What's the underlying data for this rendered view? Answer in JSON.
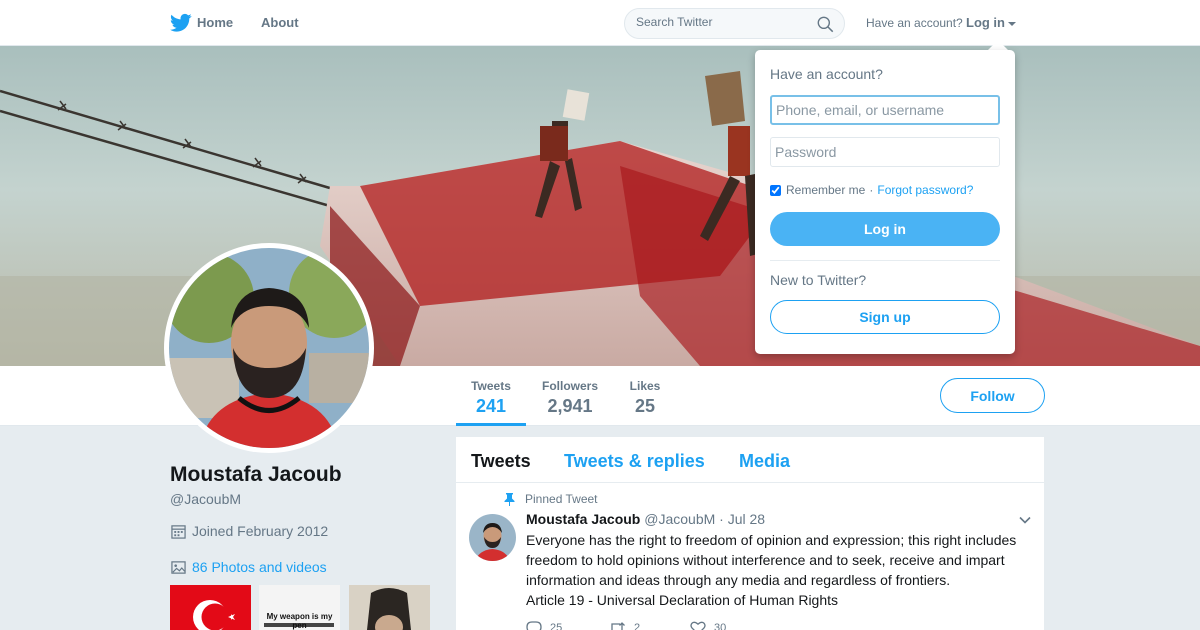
{
  "nav": {
    "home_label": "Home",
    "about_label": "About",
    "search_placeholder": "Search Twitter",
    "account_question": "Have an account?",
    "login_label": "Log in"
  },
  "profile": {
    "name": "Moustafa Jacoub",
    "handle": "@JacoubM",
    "joined": "Joined February 2012",
    "photos_link": "86 Photos and videos",
    "thumb2_caption": "My weapon is my pen"
  },
  "stats": [
    {
      "label": "Tweets",
      "value": "241"
    },
    {
      "label": "Followers",
      "value": "2,941"
    },
    {
      "label": "Likes",
      "value": "25"
    }
  ],
  "follow_label": "Follow",
  "timeline": {
    "tabs": [
      "Tweets",
      "Tweets & replies",
      "Media"
    ],
    "pinned_label": "Pinned Tweet",
    "tweet": {
      "author": "Moustafa Jacoub",
      "handle": "@JacoubM",
      "date": "Jul 28",
      "line1": "Everyone has the right to freedom of opinion and expression; this right includes",
      "line2": "freedom to hold opinions without interference and to seek, receive and impart",
      "line3": "information and ideas through any media and regardless of frontiers.",
      "line4": "Article 19 - Universal Declaration of Human Rights",
      "replies": "25",
      "retweets": "2",
      "likes": "30"
    }
  },
  "login_dropdown": {
    "title": "Have an account?",
    "username_placeholder": "Phone, email, or username",
    "password_placeholder": "Password",
    "remember_label": "Remember me",
    "separator": "·",
    "forgot_label": "Forgot password?",
    "login_button": "Log in",
    "new_question": "New to Twitter?",
    "signup_button": "Sign up"
  },
  "colors": {
    "accent": "#1da1f2",
    "muted": "#657786",
    "background": "#e6ecf0"
  }
}
